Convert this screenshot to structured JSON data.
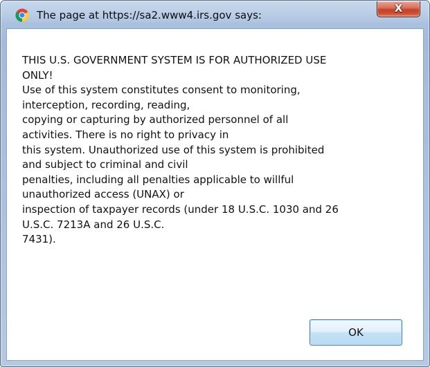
{
  "titlebar": {
    "icon": "chrome-icon",
    "title": "The page at https://sa2.www4.irs.gov says:",
    "close_glyph": "X",
    "close_icon": "close-icon"
  },
  "dialog": {
    "message_lines": [
      "THIS U.S. GOVERNMENT SYSTEM IS FOR AUTHORIZED USE",
      "ONLY!",
      "Use of this system constitutes consent to monitoring,",
      "interception, recording, reading,",
      "copying or capturing by authorized personnel of all",
      "activities.  There is no right to privacy in",
      "this system.  Unauthorized use of this system is prohibited",
      "and subject to criminal and civil",
      "penalties, including all penalties applicable to willful",
      "unauthorized access (UNAX) or",
      "inspection of taxpayer records (under 18 U.S.C. 1030 and 26",
      "U.S.C. 7213A and 26 U.S.C.",
      "7431)."
    ],
    "ok_label": "OK"
  },
  "colors": {
    "close_button": "#c4432a",
    "ok_border": "#3c7fb1",
    "frame": "#aac1de"
  }
}
